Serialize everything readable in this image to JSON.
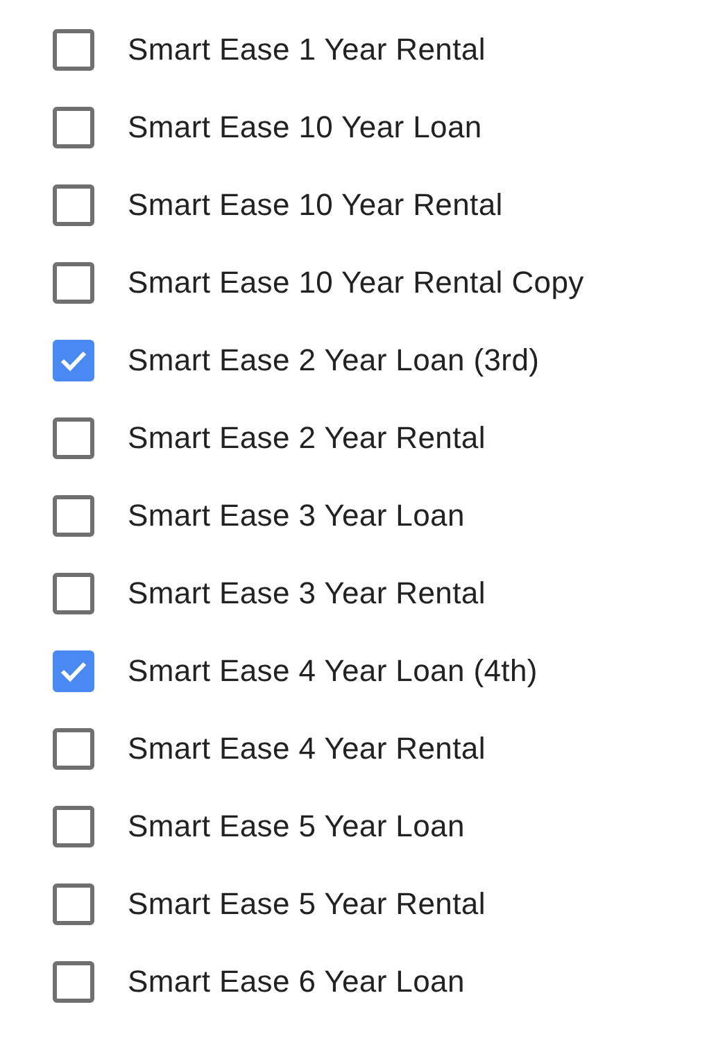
{
  "options": [
    {
      "label": "Smart Ease 1 Year Rental",
      "checked": false
    },
    {
      "label": "Smart Ease 10 Year Loan",
      "checked": false
    },
    {
      "label": "Smart Ease 10 Year Rental",
      "checked": false
    },
    {
      "label": "Smart Ease 10 Year Rental Copy",
      "checked": false
    },
    {
      "label": "Smart Ease 2 Year Loan (3rd)",
      "checked": true
    },
    {
      "label": "Smart Ease 2 Year Rental",
      "checked": false
    },
    {
      "label": "Smart Ease 3 Year Loan",
      "checked": false
    },
    {
      "label": "Smart Ease 3 Year Rental",
      "checked": false
    },
    {
      "label": "Smart Ease 4 Year Loan (4th)",
      "checked": true
    },
    {
      "label": "Smart Ease 4 Year Rental",
      "checked": false
    },
    {
      "label": "Smart Ease 5 Year Loan",
      "checked": false
    },
    {
      "label": "Smart Ease 5 Year Rental",
      "checked": false
    },
    {
      "label": "Smart Ease 6 Year Loan",
      "checked": false
    }
  ]
}
